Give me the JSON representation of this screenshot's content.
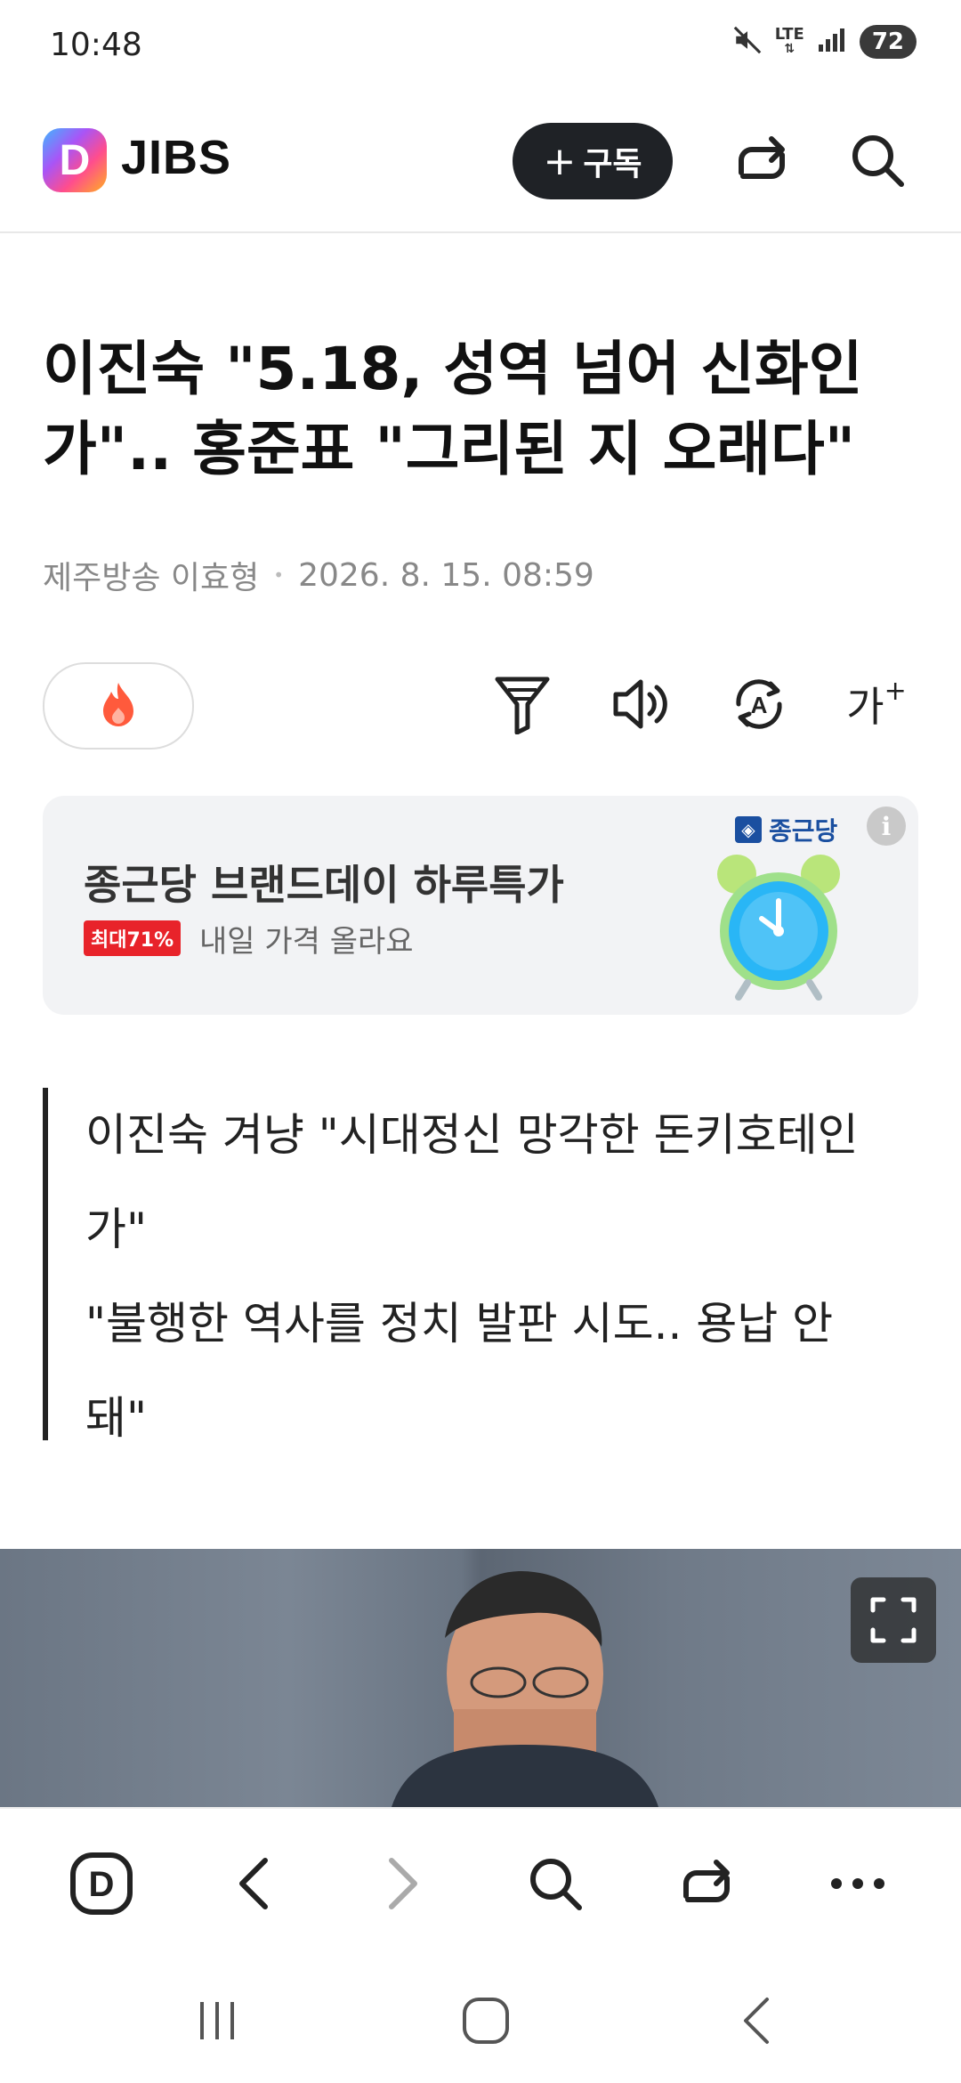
{
  "status_bar": {
    "time": "10:48",
    "network": "LTE",
    "battery": "72"
  },
  "header": {
    "logo_letter": "D",
    "brand": "JIBS",
    "subscribe_label": "구독"
  },
  "article": {
    "headline": "이진숙 \"5.18, 성역 넘어 신화인가\".. 홍준표 \"그리된 지 오래다\"",
    "byline": "제주방송 이효형",
    "date": "2026. 8. 15. 08:59",
    "summary_lines": [
      "이진숙 겨냥 \"시대정신 망각한 돈키호테인가\"",
      "\"불행한 역사를 정치 발판 시도.. 용납 안 돼\""
    ]
  },
  "tools": {
    "font_size_label": "가"
  },
  "ad": {
    "title": "종근당 브랜드데이 하루특가",
    "badge": "최대71%",
    "subtitle": "내일 가격 올라요",
    "brand": "종근당",
    "info_label": "i"
  },
  "colors": {
    "subscribe_bg": "#1f2226",
    "ad_badge": "#e8232a",
    "ad_brand": "#1a4fa0",
    "reaction_flame": "#ff5a3c"
  }
}
